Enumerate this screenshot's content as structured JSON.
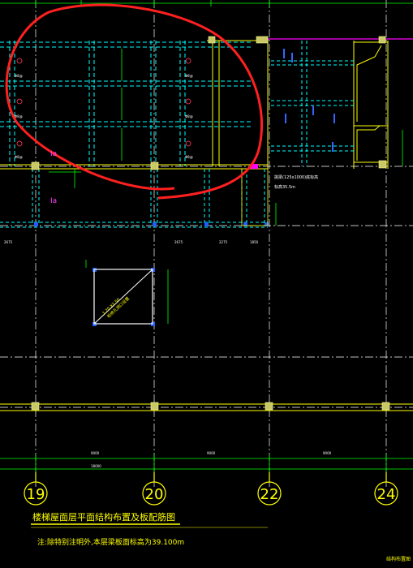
{
  "drawing": {
    "title": "楼梯屋面层平面结构布置及板配筋图",
    "note": "注:除特别注明外,本层梁板面标高为39.100m",
    "corner_note": "结构布置图",
    "annotation_beam": "挑梁(125x1000)底标高",
    "annotation_level": "标高35.5m",
    "slab_mark_1": "Ia",
    "slab_mark_2": "Ia",
    "axes": [
      "19",
      "20",
      "22",
      "24"
    ],
    "dims_bottom": [
      "9000",
      "9000",
      "9000"
    ],
    "dims_total": "18000",
    "dims_mid": [
      "2675",
      "2675",
      "2275",
      "1850"
    ],
    "panel_labels": [
      "Φ8@",
      "Φ8@",
      "Φ8@",
      "Φ8@",
      "Φ8@",
      "Φ8@"
    ],
    "diag_label": "1.20 X2.50 ",
    "diag_label2": "检修孔洞口设置"
  },
  "colors": {
    "background": "#000000",
    "grid_axis": "#ffffff",
    "beam_dashed": "#00ffff",
    "beam_solid": "#ffff00",
    "rebar": "#00ff00",
    "column": "#ffff99",
    "markup": "#ff0000",
    "anchor": "#0000ff",
    "magenta": "#ff00ff"
  }
}
